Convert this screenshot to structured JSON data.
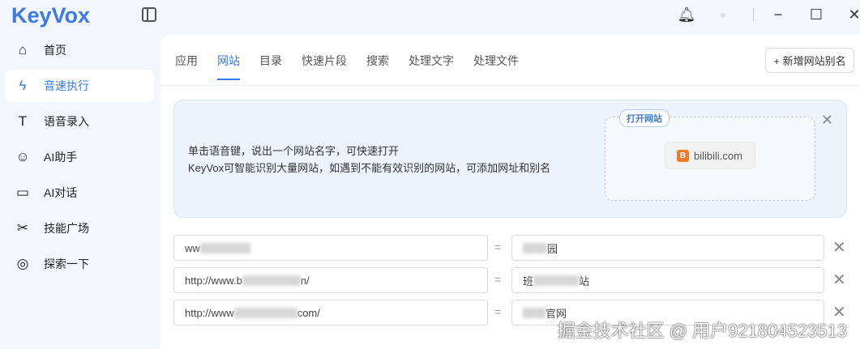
{
  "app": {
    "logo": "KeyVox"
  },
  "window": {
    "minimize": "−",
    "maximize": "☐",
    "close": "✕"
  },
  "sidebar": {
    "items": [
      {
        "label": "首页",
        "icon": "home-icon",
        "glyph": "⌂"
      },
      {
        "label": "音速执行",
        "icon": "bolt-icon",
        "glyph": "ϟ"
      },
      {
        "label": "语音录入",
        "icon": "text-icon",
        "glyph": "T"
      },
      {
        "label": "AI助手",
        "icon": "robot-icon",
        "glyph": "☺"
      },
      {
        "label": "AI对话",
        "icon": "chat-icon",
        "glyph": "▭"
      },
      {
        "label": "技能广场",
        "icon": "tools-icon",
        "glyph": "✂"
      },
      {
        "label": "探索一下",
        "icon": "explore-icon",
        "glyph": "◎"
      }
    ]
  },
  "tabs": [
    "应用",
    "网站",
    "目录",
    "快速片段",
    "搜索",
    "处理文字",
    "处理文件"
  ],
  "add_button": "+ 新增网站别名",
  "banner": {
    "line1": "单击语音键，说出一个网站名字，可快速打开",
    "line2": "KeyVox可智能识别大量网站，如遇到不能有效识别的网站，可添加网址和别名",
    "pill": "打开网站",
    "site": "bilibili.com",
    "site_icon": "B",
    "close": "✕"
  },
  "rows": [
    {
      "url_prefix": "ww",
      "url_suffix": "",
      "alias_prefix": "",
      "alias_suffix": "园"
    },
    {
      "url_prefix": "http://www.b",
      "url_suffix": "n/",
      "alias_prefix": "班",
      "alias_suffix": "站"
    },
    {
      "url_prefix": "http://www",
      "url_suffix": "com/",
      "alias_prefix": "",
      "alias_suffix": "官网"
    }
  ],
  "eq": "=",
  "remove": "✕",
  "watermark": "掘金技术社区 @ 用户921804523513"
}
